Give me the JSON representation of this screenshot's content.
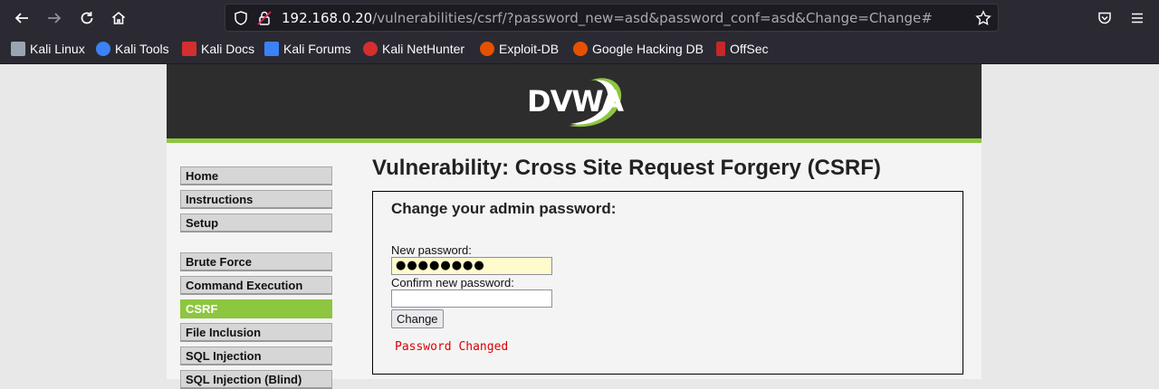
{
  "browser": {
    "url_host": "192.168.0.20",
    "url_path": "/vulnerabilities/csrf/?password_new=asd&password_conf=asd&Change=Change#",
    "icons": [
      "back-arrow-icon",
      "forward-arrow-icon",
      "reload-icon",
      "home-icon",
      "shield-icon",
      "insecure-lock-icon",
      "star-icon",
      "pocket-icon",
      "menu-icon"
    ]
  },
  "bookmarks": [
    {
      "label": "Kali Linux",
      "color": "#9aa5b1"
    },
    {
      "label": "Kali Tools",
      "color": "#3b82f6"
    },
    {
      "label": "Kali Docs",
      "color": "#d32f2f"
    },
    {
      "label": "Kali Forums",
      "color": "#3b82f6"
    },
    {
      "label": "Kali NetHunter",
      "color": "#d32f2f"
    },
    {
      "label": "Exploit-DB",
      "color": "#e65100"
    },
    {
      "label": "Google Hacking DB",
      "color": "#e65100"
    },
    {
      "label": "OffSec",
      "color": "#c62828"
    }
  ],
  "dvwa": {
    "logo": "DVWA",
    "menu": [
      {
        "label": "Home"
      },
      {
        "label": "Instructions"
      },
      {
        "label": "Setup"
      },
      {
        "label": "Brute Force"
      },
      {
        "label": "Command Execution"
      },
      {
        "label": "CSRF"
      },
      {
        "label": "File Inclusion"
      },
      {
        "label": "SQL Injection"
      },
      {
        "label": "SQL Injection (Blind)"
      }
    ],
    "selected": "CSRF",
    "title": "Vulnerability: Cross Site Request Forgery (CSRF)",
    "form": {
      "heading": "Change your admin password:",
      "new_password_label": "New password:",
      "new_password_value": "●●●●●●●●",
      "confirm_label": "Confirm new password:",
      "confirm_value": "",
      "button_label": "Change"
    },
    "message": "Password Changed",
    "accent_color": "#8dc63f"
  }
}
